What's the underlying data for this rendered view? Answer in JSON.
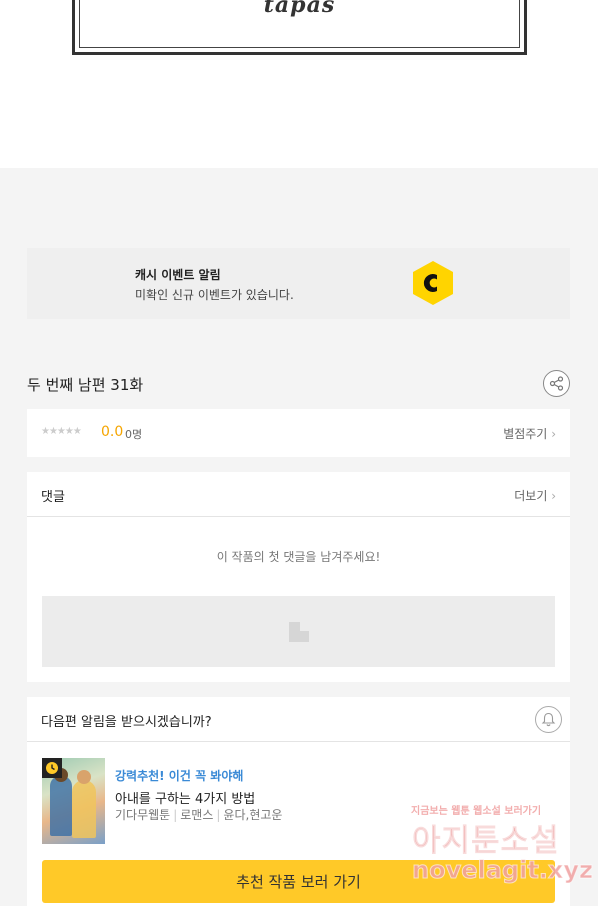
{
  "header": {
    "logo_text": "tapas"
  },
  "cash_banner": {
    "title": "캐시 이벤트 알림",
    "subtitle": "미확인 신규 이벤트가 있습니다.",
    "icon": "cash-c-icon",
    "icon_color": "#ffd400"
  },
  "episode": {
    "title": "두 번째 남편 31화"
  },
  "rating": {
    "stars": "★★★★★",
    "score": "0.0",
    "count": "0명",
    "rate_link": "별점주기"
  },
  "comments": {
    "title": "댓글",
    "more_link": "더보기",
    "empty_text": "이 작품의 첫 댓글을 남겨주세요!"
  },
  "next": {
    "question": "다음편 알림을 받으시겠습니까?",
    "recommend_label": "강력추천! 이건 꼭 봐야해",
    "work_title": "아내를 구하는 4가지 방법",
    "meta": [
      "기다무웹툰",
      "로맨스",
      "윤다,현고운"
    ],
    "cta_label": "추천 작품 보러 가기",
    "cta_color": "#ffc928"
  },
  "watermark": {
    "line1": "지금보는 웹툰 웹소설 보러가기",
    "line2": "아지툰소설",
    "line3": "novelagit.xyz"
  }
}
